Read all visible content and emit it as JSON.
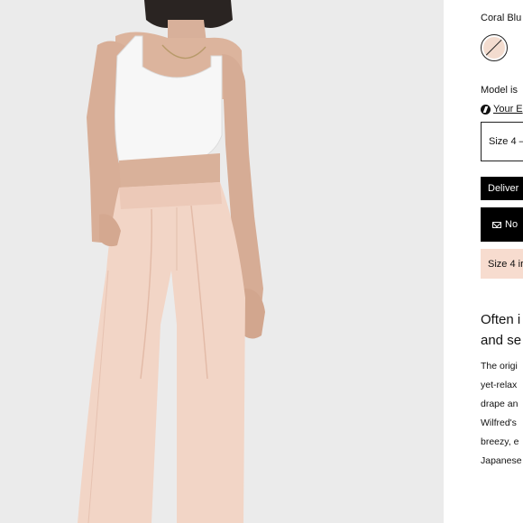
{
  "product": {
    "color_name": "Coral Blu",
    "swatch_color": "#f3dccf",
    "model_note": "Model is",
    "fit_link": "Your E",
    "size_select": "Size 4 –",
    "deliver_button": "Deliver",
    "notify_button": "No",
    "size_alert": "Size 4 ir",
    "headline": [
      "Often i",
      "and se"
    ],
    "description": [
      "The origi",
      "yet-relax",
      "drape an",
      "Wilfred's",
      "breezy, e",
      "Japanese"
    ]
  },
  "image": {
    "alt_subject": "model-wearing-pleated-trousers"
  }
}
